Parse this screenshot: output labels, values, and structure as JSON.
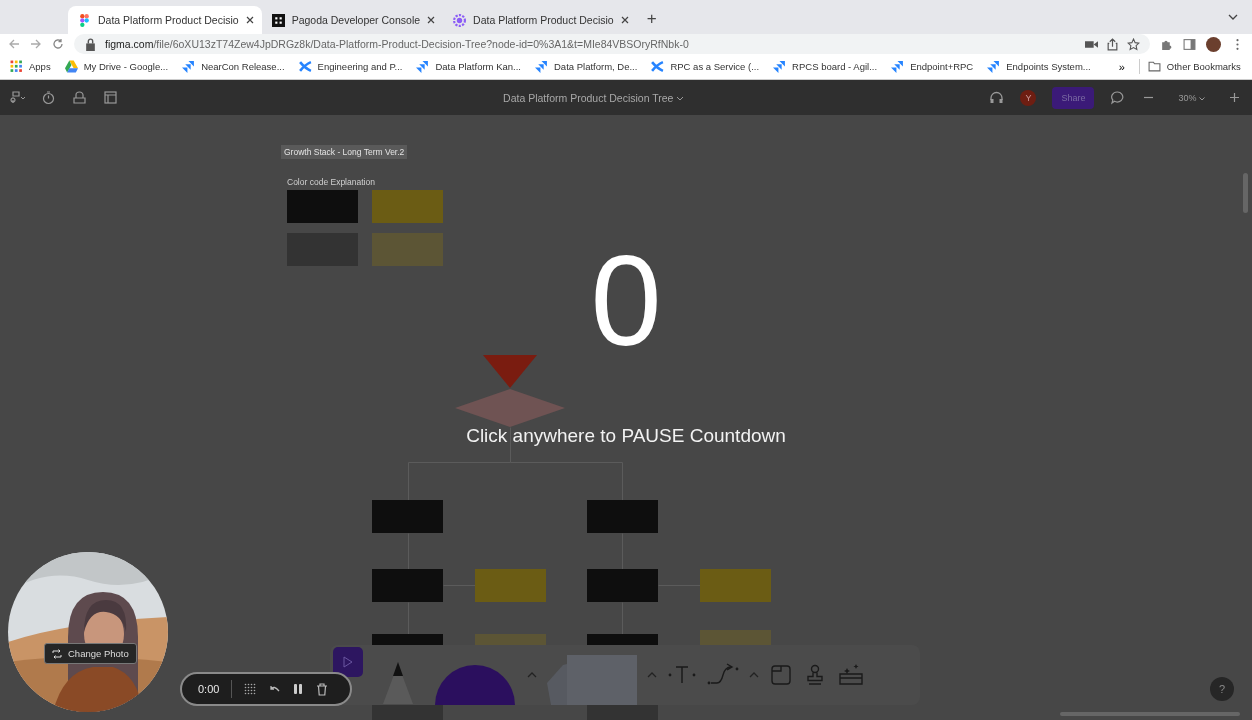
{
  "browser": {
    "tabs": [
      {
        "title": "Data Platform Product Decisio",
        "selected": true
      },
      {
        "title": "Pagoda Developer Console",
        "selected": false
      },
      {
        "title": "Data Platform Product Decisio",
        "selected": false
      }
    ],
    "new_tab": "+",
    "url_host": "figma.com",
    "url_path": "/file/6oXU13zT74Zew4JpDRGz8k/Data-Platform-Product-Decision-Tree?node-id=0%3A1&t=MIe84VBSOryRfNbk-0",
    "bookmarks": [
      {
        "label": "Apps"
      },
      {
        "label": "My Drive - Google..."
      },
      {
        "label": "NearCon Release..."
      },
      {
        "label": "Engineering and P..."
      },
      {
        "label": "Data Platform Kan..."
      },
      {
        "label": "Data Platform, De..."
      },
      {
        "label": "RPC as a Service (..."
      },
      {
        "label": "RPCS board - Agil..."
      },
      {
        "label": "Endpoint+RPC"
      },
      {
        "label": "Endpoints System..."
      }
    ],
    "more": "»",
    "other_bookmarks": "Other Bookmarks"
  },
  "editor": {
    "file_title": "Data Platform Product Decision Tree",
    "avatar": "Y",
    "share": "Share",
    "zoom": "30%"
  },
  "canvas": {
    "frame_label": "Growth Stack - Long Term Ver.2",
    "legend_title": "Color code Explanation",
    "legend": [
      {
        "color": "#0e0e0e"
      },
      {
        "color": "#6b5c14"
      },
      {
        "color": "#333333"
      },
      {
        "color": "#5c5535"
      }
    ],
    "nodes": [
      {
        "kind": "start"
      },
      {
        "kind": "decision"
      },
      {
        "kind": "question"
      },
      {
        "kind": "question"
      },
      {
        "kind": "question"
      },
      {
        "kind": "tool"
      },
      {
        "kind": "question"
      },
      {
        "kind": "tool"
      },
      {
        "kind": "question"
      },
      {
        "kind": "planned"
      },
      {
        "kind": "question"
      },
      {
        "kind": "planned"
      },
      {
        "kind": "request"
      },
      {
        "kind": "request"
      }
    ]
  },
  "countdown": {
    "number": "0",
    "message": "Click anywhere to PAUSE Countdown"
  },
  "recorder": {
    "time": "0:00",
    "change_photo": "Change Photo"
  },
  "help": "?"
}
